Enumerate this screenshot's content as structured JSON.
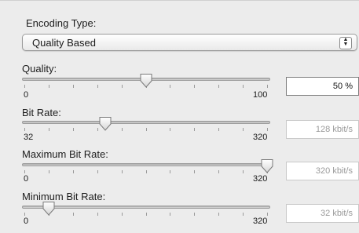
{
  "encoding": {
    "label": "Encoding Type:",
    "value": "Quality Based"
  },
  "sliders": [
    {
      "id": "quality",
      "label": "Quality:",
      "min_label": "0",
      "max_label": "100",
      "value_fraction": 0.5,
      "field_value": "50 %",
      "field_enabled": true
    },
    {
      "id": "bit-rate",
      "label": "Bit Rate:",
      "min_label": "32",
      "max_label": "320",
      "value_fraction": 0.333,
      "field_value": "128 kbit/s",
      "field_enabled": false
    },
    {
      "id": "maximum-bit-rate",
      "label": "Maximum Bit Rate:",
      "min_label": "0",
      "max_label": "320",
      "value_fraction": 1.0,
      "field_value": "320 kbit/s",
      "field_enabled": false
    },
    {
      "id": "minimum-bit-rate",
      "label": "Minimum Bit Rate:",
      "min_label": "0",
      "max_label": "320",
      "value_fraction": 0.1,
      "field_value": "32 kbit/s",
      "field_enabled": false
    }
  ]
}
